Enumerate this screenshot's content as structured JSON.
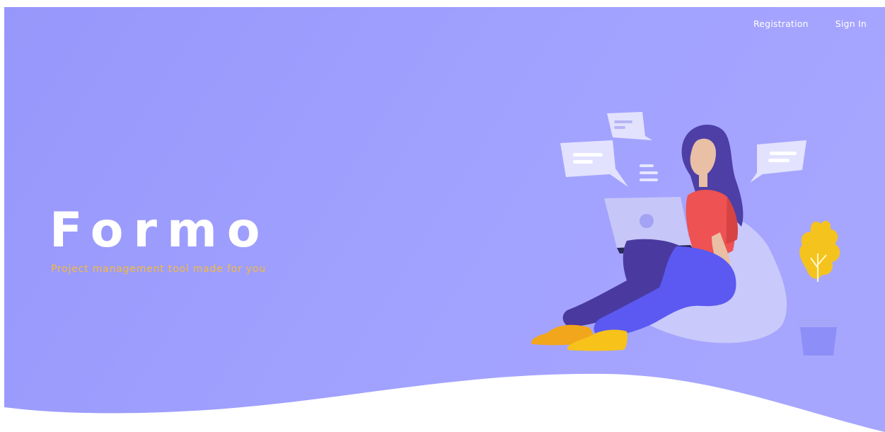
{
  "nav": {
    "registration_label": "Registration",
    "signin_label": "Sign In"
  },
  "brand": {
    "title": "Formo",
    "tagline": "Project management tool made for you"
  },
  "colors": {
    "hero_background": "#9b9bfd",
    "tagline": "#f5b93a",
    "text": "#ffffff"
  },
  "illustration": {
    "icon": "woman-with-laptop-illustration"
  }
}
